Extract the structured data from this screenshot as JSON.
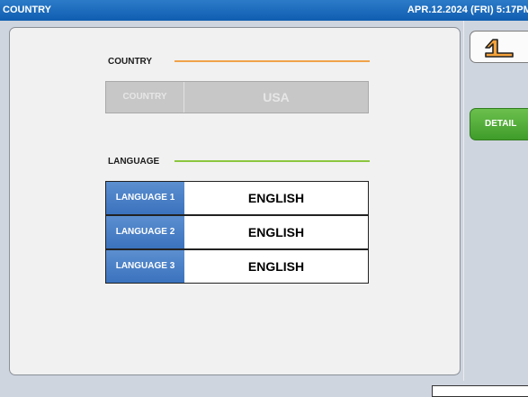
{
  "titlebar": {
    "title": "COUNTRY",
    "datetime": "APR.12.2024 (FRI)  5:17PM"
  },
  "country_section": {
    "heading": "COUNTRY",
    "line_color": "#f0a24b",
    "field_label": "COUNTRY",
    "field_value": "USA"
  },
  "language_section": {
    "heading": "LANGUAGE",
    "line_color": "#8cc63f",
    "rows": [
      {
        "label": "LANGUAGE 1",
        "value": "ENGLISH"
      },
      {
        "label": "LANGUAGE 2",
        "value": "ENGLISH"
      },
      {
        "label": "LANGUAGE 3",
        "value": "ENGLISH"
      }
    ]
  },
  "side": {
    "back_icon": "return-arrow-icon",
    "detail_label": "DETAIL"
  }
}
